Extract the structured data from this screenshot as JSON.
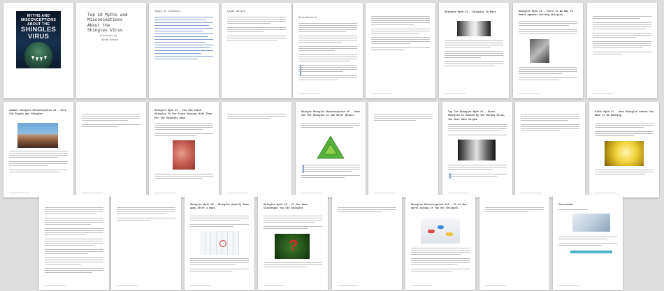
{
  "book": {
    "cover_line1": "MYTHS AND",
    "cover_line2": "MISCONCEPTIONS",
    "cover_line3": "ABOUT THE",
    "cover_line4": "SHINGLES",
    "cover_line5": "VIRUS",
    "title_line1": "Top 10 Myths and",
    "title_line2": "Misconceptions",
    "title_line3": "About the",
    "title_line4": "Shingles Virus",
    "presented_by": "Presented by",
    "author": "Sarah Brands"
  },
  "headings": {
    "p3": "Table of Contents",
    "p4": "Legal Notice",
    "p5": "Introduction",
    "p7": "Shingles Myth #1 - Shingles Is Rare",
    "p8": "Shingles Myth #2 - There Is No Way To Guard Against Getting Shingles",
    "p10": "Common Shingles Misconception #3 - Only Old People get Shingles",
    "p12": "Shingles Myth #4 - You Can Catch Shingles If You Touch Someone With Them For The Shingles Rash",
    "p14": "Shingle Shingles Misconception #5 - Once You Get Shingles It Can Never Return",
    "p16": "Top Ten Shingles Myth #6 - Since Shingles Is Caused by the Herpes Virus, You Must Have Herpes",
    "p18": "Fifth Myth #7 - Once Shingles Leaves You Have to Do Nothing",
    "p21": "Shingles Myth #8 - Shingles Usually Goes Away After 3 Days",
    "p22": "Shingles Myth #9 - If You Have Chickenpox You Get Shingles",
    "p24": "Shingles Misconception #10 - It Is Not Worth Caring if You Get Shingles",
    "p25": "Conclusion"
  },
  "footer": {
    "text": "Myths About Shingles"
  },
  "page_numbers": [
    "1",
    "2",
    "3",
    "4",
    "5",
    "6",
    "7",
    "8",
    "9",
    "10",
    "11",
    "12",
    "13",
    "14",
    "15",
    "16",
    "17",
    "18",
    "19",
    "20",
    "21",
    "22",
    "23",
    "24",
    "25"
  ]
}
